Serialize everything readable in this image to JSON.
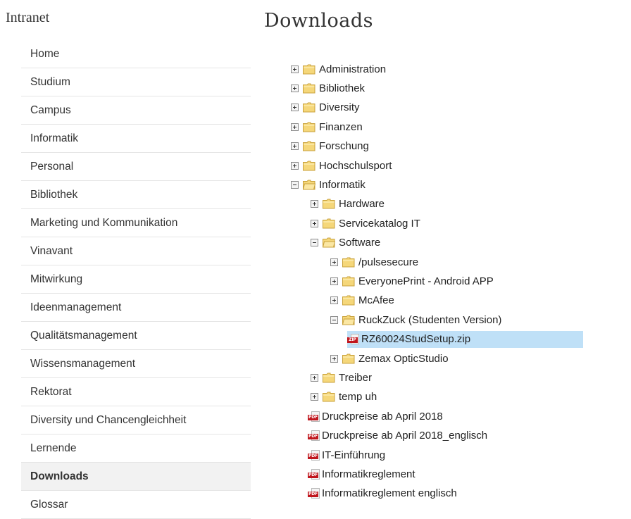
{
  "sidebar": {
    "title": "Intranet",
    "items": [
      {
        "label": "Home"
      },
      {
        "label": "Studium"
      },
      {
        "label": "Campus"
      },
      {
        "label": "Informatik"
      },
      {
        "label": "Personal"
      },
      {
        "label": "Bibliothek"
      },
      {
        "label": "Marketing und Kommunikation"
      },
      {
        "label": "Vinavant"
      },
      {
        "label": "Mitwirkung"
      },
      {
        "label": "Ideenmanagement"
      },
      {
        "label": "Qualitätsmanagement"
      },
      {
        "label": "Wissensmanagement"
      },
      {
        "label": "Rektorat"
      },
      {
        "label": "Diversity und Chancengleichheit"
      },
      {
        "label": "Lernende"
      },
      {
        "label": "Downloads",
        "active": true
      },
      {
        "label": "Glossar"
      }
    ]
  },
  "main": {
    "title": "Downloads",
    "tree": [
      {
        "label": "Administration",
        "depth": 0,
        "kind": "folder",
        "state": "collapsed"
      },
      {
        "label": "Bibliothek",
        "depth": 0,
        "kind": "folder",
        "state": "collapsed"
      },
      {
        "label": "Diversity",
        "depth": 0,
        "kind": "folder",
        "state": "collapsed"
      },
      {
        "label": "Finanzen",
        "depth": 0,
        "kind": "folder",
        "state": "collapsed"
      },
      {
        "label": "Forschung",
        "depth": 0,
        "kind": "folder",
        "state": "collapsed"
      },
      {
        "label": "Hochschulsport",
        "depth": 0,
        "kind": "folder",
        "state": "collapsed"
      },
      {
        "label": "Informatik",
        "depth": 0,
        "kind": "folder",
        "state": "expanded"
      },
      {
        "label": "Hardware",
        "depth": 1,
        "kind": "folder",
        "state": "collapsed"
      },
      {
        "label": "Servicekatalog IT",
        "depth": 1,
        "kind": "folder",
        "state": "collapsed"
      },
      {
        "label": "Software",
        "depth": 1,
        "kind": "folder",
        "state": "expanded"
      },
      {
        "label": "/pulsesecure",
        "depth": 2,
        "kind": "folder",
        "state": "collapsed"
      },
      {
        "label": "EveryonePrint - Android APP",
        "depth": 2,
        "kind": "folder",
        "state": "collapsed"
      },
      {
        "label": "McAfee",
        "depth": 2,
        "kind": "folder",
        "state": "collapsed"
      },
      {
        "label": "RuckZuck (Studenten Version)",
        "depth": 2,
        "kind": "folder",
        "state": "expanded"
      },
      {
        "label": "RZ60024StudSetup.zip",
        "depth": 3,
        "kind": "zip",
        "icon": "zip-file-icon",
        "selected": true
      },
      {
        "label": "Zemax OpticStudio",
        "depth": 2,
        "kind": "folder",
        "state": "collapsed"
      },
      {
        "label": "Treiber",
        "depth": 1,
        "kind": "folder",
        "state": "collapsed"
      },
      {
        "label": "temp uh",
        "depth": 1,
        "kind": "folder",
        "state": "collapsed"
      },
      {
        "label": "Druckpreise ab April 2018",
        "depth": 1,
        "kind": "pdf",
        "icon": "pdf-file-icon"
      },
      {
        "label": "Druckpreise ab April 2018_englisch",
        "depth": 1,
        "kind": "pdf",
        "icon": "pdf-file-icon"
      },
      {
        "label": "IT-Einführung",
        "depth": 1,
        "kind": "pdf",
        "icon": "pdf-file-icon"
      },
      {
        "label": "Informatikreglement",
        "depth": 1,
        "kind": "pdf",
        "icon": "pdf-file-icon"
      },
      {
        "label": "Informatikreglement englisch",
        "depth": 1,
        "kind": "pdf",
        "icon": "pdf-file-icon"
      }
    ]
  },
  "icons": {
    "toggle_collapsed": "expand-plus-icon",
    "toggle_expanded": "collapse-minus-icon",
    "folder_closed": "folder-icon",
    "folder_open": "folder-open-icon",
    "zip_tag": "ZIP",
    "pdf_tag": "PDF"
  },
  "colors": {
    "selection": "#bfe0f7",
    "folder": "#f5d77a",
    "file_tag": "#c0161d",
    "active_nav": "#f2f2f2"
  }
}
